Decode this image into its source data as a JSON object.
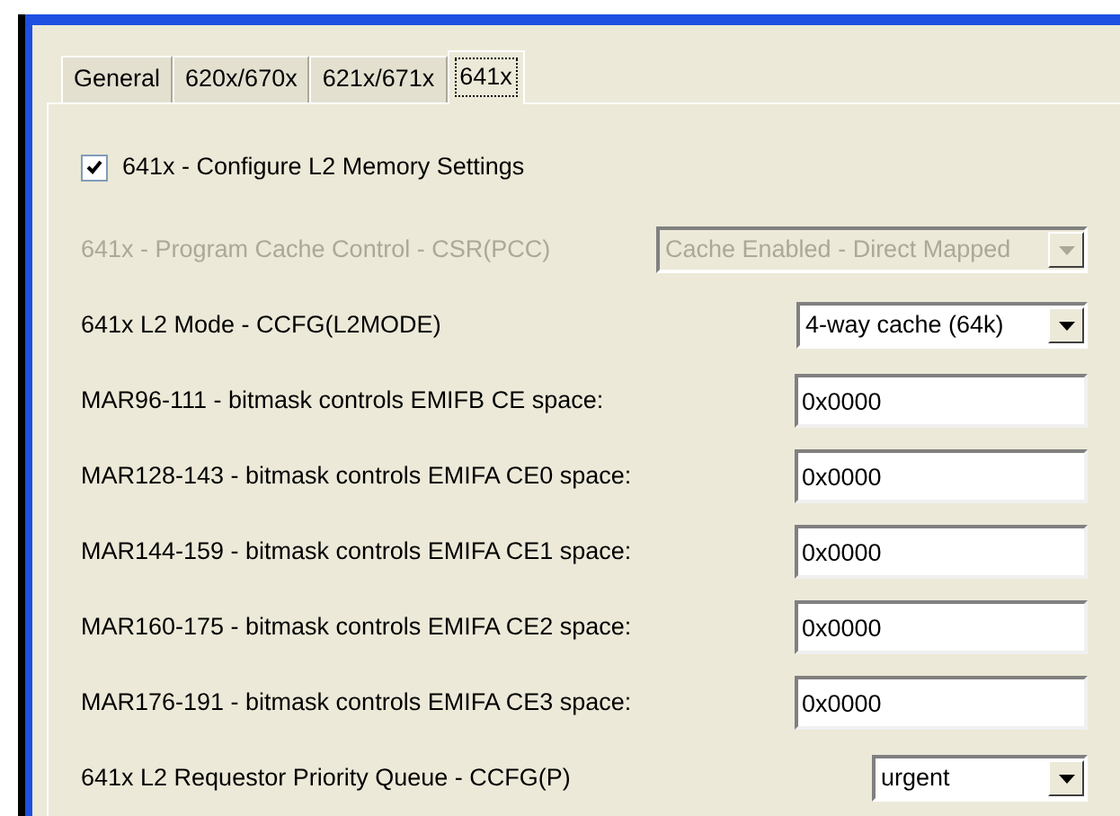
{
  "tabs": [
    {
      "label": "General",
      "selected": false
    },
    {
      "label": "620x/670x",
      "selected": false
    },
    {
      "label": "621x/671x",
      "selected": false
    },
    {
      "label": "641x",
      "selected": true
    }
  ],
  "configure": {
    "label": "641x - Configure L2 Memory Settings",
    "checked": true
  },
  "settings": [
    {
      "kind": "combo",
      "label": "641x - Program Cache Control - CSR(PCC)",
      "value": "Cache Enabled - Direct Mapped",
      "disabled": true
    },
    {
      "kind": "combo",
      "label": "641x L2 Mode - CCFG(L2MODE)",
      "value": "4-way cache (64k)",
      "disabled": false
    },
    {
      "kind": "text",
      "label": "MAR96-111 - bitmask controls EMIFB CE space:",
      "value": "0x0000",
      "disabled": false
    },
    {
      "kind": "text",
      "label": "MAR128-143 - bitmask controls EMIFA CE0 space:",
      "value": "0x0000",
      "disabled": false
    },
    {
      "kind": "text",
      "label": "MAR144-159 - bitmask controls EMIFA CE1 space:",
      "value": "0x0000",
      "disabled": false
    },
    {
      "kind": "text",
      "label": "MAR160-175 - bitmask controls EMIFA CE2 space:",
      "value": "0x0000",
      "disabled": false
    },
    {
      "kind": "text",
      "label": "MAR176-191 - bitmask controls EMIFA CE3 space:",
      "value": "0x0000",
      "disabled": false
    },
    {
      "kind": "combo",
      "label": "641x L2 Requestor Priority Queue - CCFG(P)",
      "value": "urgent",
      "disabled": false
    }
  ]
}
